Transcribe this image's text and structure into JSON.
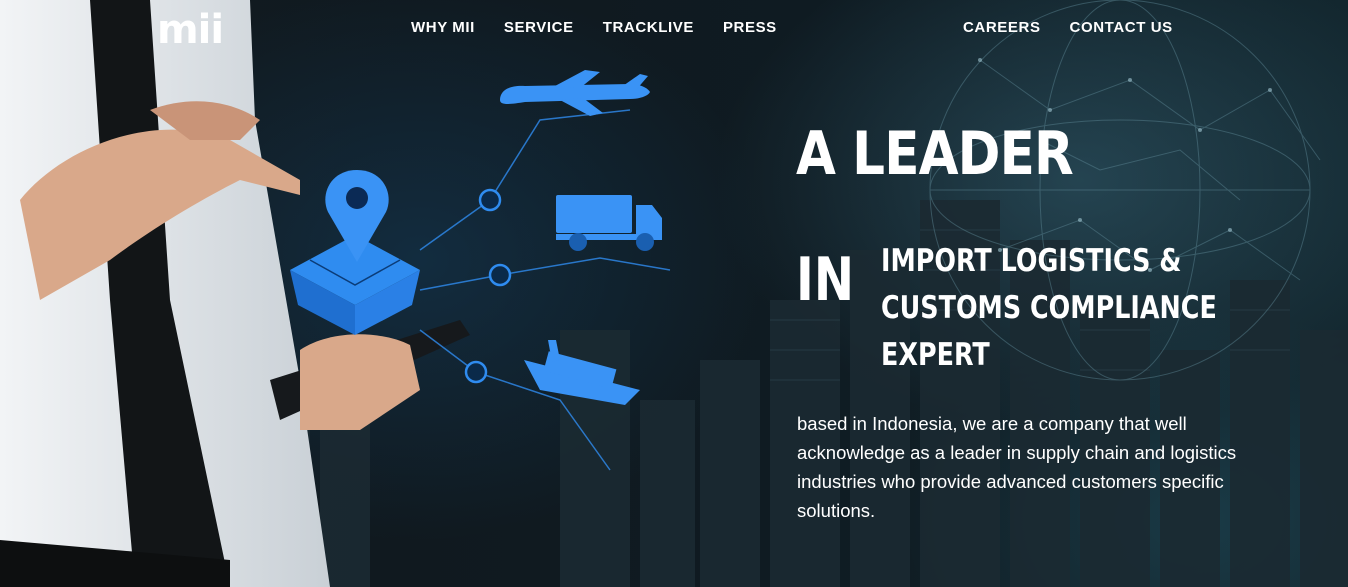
{
  "brand": {
    "logo_text": "mii"
  },
  "nav": {
    "left": [
      {
        "label": "WHY MII"
      },
      {
        "label": "SERVICE"
      },
      {
        "label": "TRACKLIVE"
      },
      {
        "label": "PRESS"
      }
    ],
    "right": [
      {
        "label": "CAREERS"
      },
      {
        "label": "CONTACT US"
      }
    ]
  },
  "hero": {
    "headline": "A LEADER",
    "in_word": "IN",
    "subheadline_lines": [
      "IMPORT LOGISTICS &",
      "CUSTOMS COMPLIANCE",
      "EXPERT"
    ],
    "description": "based in Indonesia, we are a company that well acknowledge as a leader in supply chain and logistics industries who provide advanced customers specific solutions."
  },
  "colors": {
    "accent_blue": "#2f8cf0",
    "text": "#ffffff",
    "background": "#10191f"
  },
  "icons": [
    "airplane-icon",
    "truck-icon",
    "ship-icon",
    "location-pin-icon",
    "package-box-icon",
    "globe-network-icon"
  ]
}
